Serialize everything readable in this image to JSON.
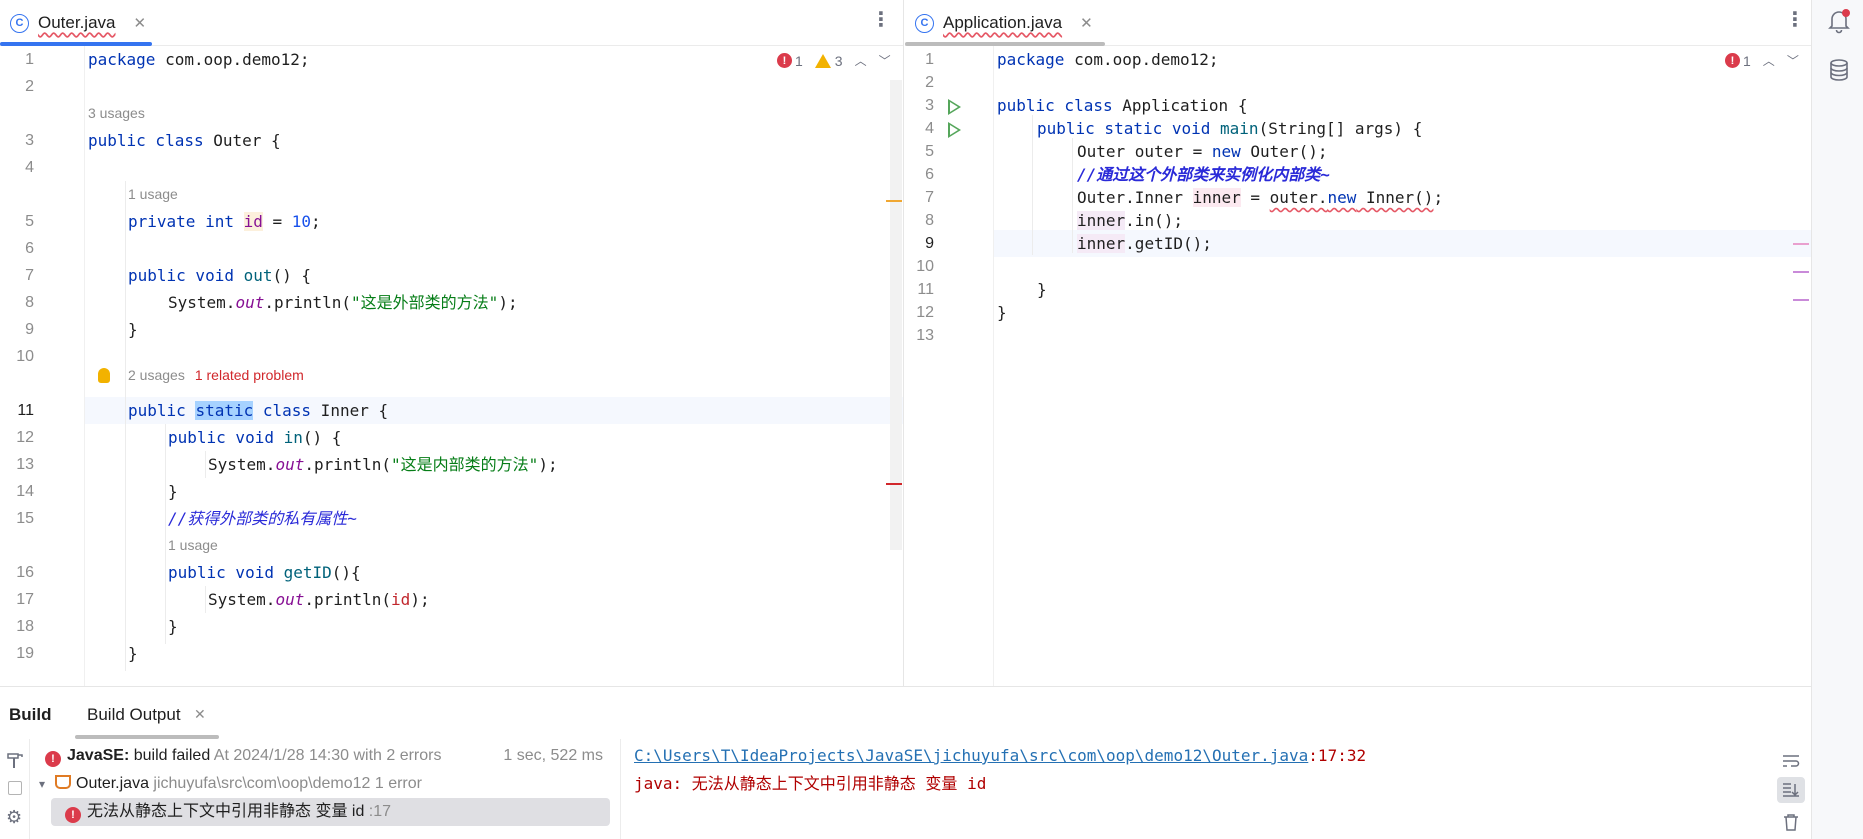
{
  "left_editor": {
    "tab_title": "Outer.java",
    "tab_icon": "C",
    "errors": "1",
    "warnings": "3",
    "lines": [
      {
        "n": "1"
      },
      {
        "n": "2"
      },
      {
        "n": "3"
      },
      {
        "n": "4"
      },
      {
        "n": "5"
      },
      {
        "n": "6"
      },
      {
        "n": "7"
      },
      {
        "n": "8"
      },
      {
        "n": "9"
      },
      {
        "n": "10"
      },
      {
        "n": "11"
      },
      {
        "n": "12"
      },
      {
        "n": "13"
      },
      {
        "n": "14"
      },
      {
        "n": "15"
      },
      {
        "n": "16"
      },
      {
        "n": "17"
      },
      {
        "n": "18"
      },
      {
        "n": "19"
      }
    ],
    "code": {
      "l1_kw": "package",
      "l1_rest": " com.oop.demo12;",
      "hint3": "3 usages",
      "l3_kw": "public class",
      "l3_rest": " Outer {",
      "hint5": "1 usage",
      "l5_kw": "private int",
      "l5_sp": " ",
      "l5_field": "id",
      "l5_eq": " = ",
      "l5_num": "10",
      "l5_end": ";",
      "l7_kw": "public void",
      "l7_sp": " ",
      "l7_method": "out",
      "l7_end": "() {",
      "l8_a": "System.",
      "l8_out": "out",
      "l8_b": ".println(",
      "l8_str": "\"这是外部类的方法\"",
      "l8_end": ");",
      "l9": "}",
      "hint11_usages": "2 usages",
      "hint11_problem": "1 related problem",
      "l11_kw": "public",
      "l11_sel": "static",
      "l11_kw2": "class",
      "l11_rest": " Inner {",
      "l12_kw": "public void",
      "l12_sp": " ",
      "l12_method": "in",
      "l12_end": "() {",
      "l13_a": "System.",
      "l13_out": "out",
      "l13_b": ".println(",
      "l13_str": "\"这是内部类的方法\"",
      "l13_end": ");",
      "l14": "}",
      "l15_cmt": "//获得外部类的私有属性~",
      "hint16": "1 usage",
      "l16_kw": "public void",
      "l16_sp": " ",
      "l16_method": "getID",
      "l16_end": "(){",
      "l17_a": "System.",
      "l17_out": "out",
      "l17_b": ".println(",
      "l17_field": "id",
      "l17_end": ");",
      "l18": "}",
      "l19": "}"
    }
  },
  "right_editor": {
    "tab_title": "Application.java",
    "tab_icon": "C",
    "errors": "1",
    "lines": [
      {
        "n": "1"
      },
      {
        "n": "2"
      },
      {
        "n": "3"
      },
      {
        "n": "4"
      },
      {
        "n": "5"
      },
      {
        "n": "6"
      },
      {
        "n": "7"
      },
      {
        "n": "8"
      },
      {
        "n": "9"
      },
      {
        "n": "10"
      },
      {
        "n": "11"
      },
      {
        "n": "12"
      },
      {
        "n": "13"
      }
    ],
    "code": {
      "l1_kw": "package",
      "l1_rest": " com.oop.demo12;",
      "l3_kw": "public class",
      "l3_rest": " Application {",
      "l4_kw": "public static void",
      "l4_sp": " ",
      "l4_method": "main",
      "l4_end": "(String[] args) {",
      "l5_a": "Outer outer = ",
      "l5_kw": "new",
      "l5_b": " Outer();",
      "l6_cmt": "//通过这个外部类来实例化内部类~",
      "l7_a": "Outer.Inner ",
      "l7_var": "inner",
      "l7_b": " = ",
      "l7_err_a": "outer.",
      "l7_err_kw": "new",
      "l7_err_b": " Inner()",
      "l7_end": ";",
      "l8_var": "inner",
      "l8_rest": ".in();",
      "l9_var": "inner",
      "l9_rest": ".getID();",
      "l11": "}",
      "l12": "}"
    }
  },
  "build": {
    "title": "Build",
    "tab": "Build Output",
    "tree": {
      "row1_bold": "JavaSE:",
      "row1_text": " build failed",
      "row1_grey": " At 2024/1/28 14:30 with 2 errors",
      "row1_time": "1 sec, 522 ms",
      "row2_text": "Outer.java",
      "row2_grey": " jichuyufa\\src\\com\\oop\\demo12 1 error",
      "row3_text": "无法从静态上下文中引用非静态 变量 id",
      "row3_grey": " :17"
    },
    "output": {
      "path": "C:\\Users\\T\\IdeaProjects\\JavaSE\\jichuyufa\\src\\com\\oop\\demo12\\Outer.java",
      "pos": ":17:32",
      "message": "java: 无法从静态上下文中引用非静态 变量 id"
    }
  },
  "colors": {
    "accent": "#3574f0",
    "error": "#db3b4b",
    "warning": "#f2b200",
    "keyword": "#0033b3",
    "string": "#067d17",
    "comment": "#2a2ad8"
  },
  "icons": {
    "notifications": "bell-icon",
    "database": "database-icon",
    "hammer": "hammer-icon",
    "stop": "stop-icon",
    "settings": "gear-icon",
    "soft_wrap": "soft-wrap-icon",
    "scroll_end": "scroll-to-end-icon",
    "trash": "trash-icon"
  }
}
